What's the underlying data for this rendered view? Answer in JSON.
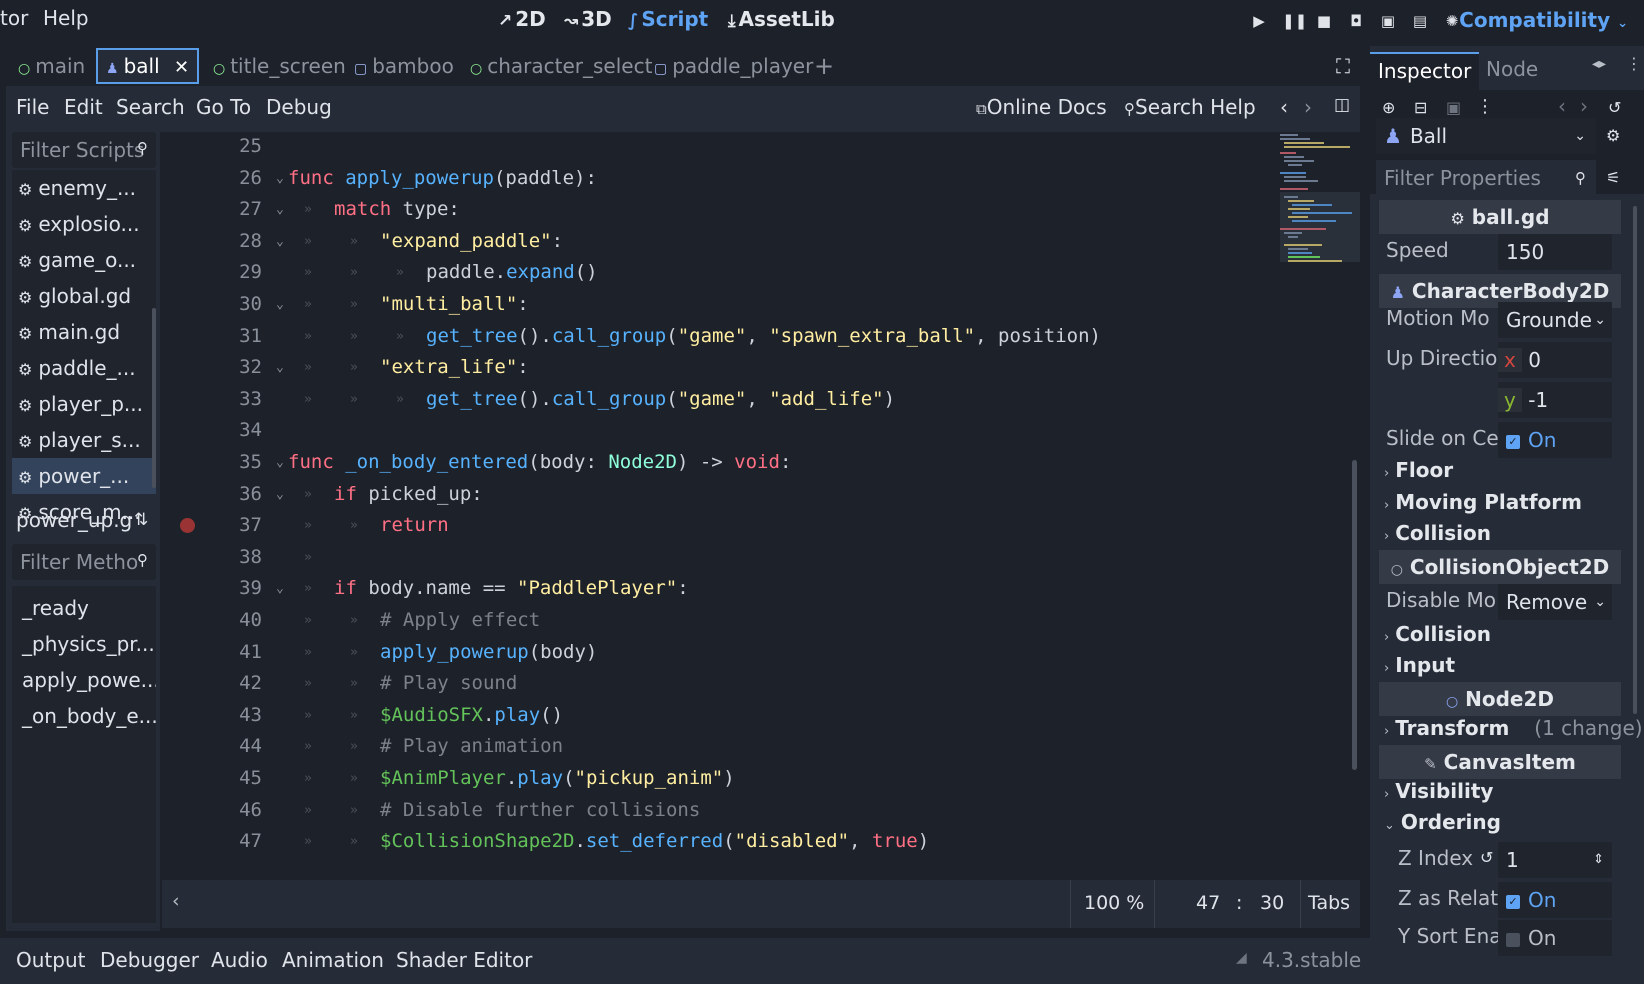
{
  "topbar": {
    "menus": [
      "tor",
      "Help"
    ],
    "workspaces": [
      {
        "label": "2D",
        "glyph": "↗"
      },
      {
        "label": "3D",
        "glyph": "↝"
      },
      {
        "label": "Script",
        "glyph": "∫"
      },
      {
        "label": "AssetLib",
        "glyph": "⤓"
      }
    ],
    "active_workspace": "Script",
    "renderer": "Compatibility"
  },
  "scene_tabs": [
    {
      "label": "main",
      "icon": "circle-icon"
    },
    {
      "label": "ball",
      "icon": "character-icon",
      "selected": true
    },
    {
      "label": "title_screen",
      "icon": "circle-icon"
    },
    {
      "label": "bamboo",
      "icon": "square-icon"
    },
    {
      "label": "character_select",
      "icon": "circle-icon"
    },
    {
      "label": "paddle_player",
      "icon": "square-icon"
    }
  ],
  "script_menu": [
    "File",
    "Edit",
    "Search",
    "Go To",
    "Debug"
  ],
  "script_buttons": {
    "online_docs": "Online Docs",
    "search_help": "Search Help"
  },
  "script_list": {
    "filter_placeholder": "Filter Scripts",
    "items": [
      "enemy_...",
      "explosio...",
      "game_o...",
      "global.gd",
      "main.gd",
      "paddle_...",
      "player_p...",
      "player_s...",
      "power_...",
      "score_m..."
    ],
    "selected": "power_..."
  },
  "current_script": "power_up.g",
  "methods": {
    "filter_placeholder": "Filter Metho",
    "items": [
      "_ready",
      "_physics_pr...",
      "apply_powe...",
      "_on_body_e..."
    ]
  },
  "code_lines": [
    {
      "n": "25",
      "fold": false,
      "tabs": 0,
      "html": ""
    },
    {
      "n": "26",
      "fold": true,
      "tabs": 0,
      "html": "<span class='kw'>func</span> <span class='fn'>apply_powerup</span>(paddle):"
    },
    {
      "n": "27",
      "fold": true,
      "tabs": 1,
      "html": "<span class='kw'>match</span> type:"
    },
    {
      "n": "28",
      "fold": true,
      "tabs": 2,
      "html": "<span class='st'>\"expand_paddle\"</span>:"
    },
    {
      "n": "29",
      "fold": false,
      "tabs": 3,
      "html": "paddle.<span class='fn'>expand</span>()"
    },
    {
      "n": "30",
      "fold": true,
      "tabs": 2,
      "html": "<span class='st'>\"multi_ball\"</span>:"
    },
    {
      "n": "31",
      "fold": false,
      "tabs": 3,
      "html": "<span class='fn'>get_tree</span>().<span class='fn'>call_group</span>(<span class='st'>\"game\"</span>, <span class='st'>\"spawn_extra_ball\"</span>, position)"
    },
    {
      "n": "32",
      "fold": true,
      "tabs": 2,
      "html": "<span class='st'>\"extra_life\"</span>:"
    },
    {
      "n": "33",
      "fold": false,
      "tabs": 3,
      "html": "<span class='fn'>get_tree</span>().<span class='fn'>call_group</span>(<span class='st'>\"game\"</span>, <span class='st'>\"add_life\"</span>)"
    },
    {
      "n": "34",
      "fold": false,
      "tabs": 0,
      "html": ""
    },
    {
      "n": "35",
      "fold": true,
      "tabs": 0,
      "html": "<span class='kw'>func</span> <span class='fn'>_on_body_entered</span>(body: <span class='ty'>Node2D</span>) -&gt; <span class='kw'>void</span>:"
    },
    {
      "n": "36",
      "fold": true,
      "tabs": 1,
      "html": "<span class='kw'>if</span> picked_up:"
    },
    {
      "n": "37",
      "fold": false,
      "tabs": 2,
      "html": "<span class='kw'>return</span>"
    },
    {
      "n": "38",
      "fold": false,
      "tabs": 1,
      "html": ""
    },
    {
      "n": "39",
      "fold": true,
      "tabs": 1,
      "html": "<span class='kw'>if</span> body.name == <span class='st'>\"PaddlePlayer\"</span>:"
    },
    {
      "n": "40",
      "fold": false,
      "tabs": 2,
      "html": "<span class='cm'># Apply effect</span>"
    },
    {
      "n": "41",
      "fold": false,
      "tabs": 2,
      "html": "<span class='fn'>apply_powerup</span>(body)"
    },
    {
      "n": "42",
      "fold": false,
      "tabs": 2,
      "html": "<span class='cm'># Play sound</span>"
    },
    {
      "n": "43",
      "fold": false,
      "tabs": 2,
      "html": "<span class='nd'>$AudioSFX</span>.<span class='fn'>play</span>()"
    },
    {
      "n": "44",
      "fold": false,
      "tabs": 2,
      "html": "<span class='cm'># Play animation</span>"
    },
    {
      "n": "45",
      "fold": false,
      "tabs": 2,
      "html": "<span class='nd'>$AnimPlayer</span>.<span class='fn'>play</span>(<span class='st'>\"pickup_anim\"</span>)"
    },
    {
      "n": "46",
      "fold": false,
      "tabs": 2,
      "html": "<span class='cm'># Disable further collisions</span>"
    },
    {
      "n": "47",
      "fold": false,
      "tabs": 2,
      "html": "<span class='nd'>$CollisionShape2D</span>.<span class='fn'>set_deferred</span>(<span class='st'>\"disabled\"</span>, <span class='kw'>true</span>)"
    }
  ],
  "breakpoint_line": "37",
  "status": {
    "zoom": "100 %",
    "line": "47",
    "sep": ":",
    "col": "30",
    "indent": "Tabs"
  },
  "bottom_panels": [
    "Output",
    "Debugger",
    "Audio",
    "Animation",
    "Shader Editor"
  ],
  "version": "4.3.stable",
  "inspector": {
    "tabs": [
      "Inspector",
      "Node"
    ],
    "node_name": "Ball",
    "filter_placeholder": "Filter Properties",
    "script_section": "ball.gd",
    "speed_label": "Speed",
    "speed_value": "150",
    "body_section": "CharacterBody2D",
    "motion_label": "Motion Mo",
    "motion_value": "Grounde",
    "updir_label": "Up Directio",
    "updir_x_label": "x",
    "updir_x": "0",
    "updir_y_label": "y",
    "updir_y": "-1",
    "slide_label": "Slide on Cei",
    "slide_value": "On",
    "floor": "Floor",
    "moving_platform": "Moving Platform",
    "collision": "Collision",
    "collobj_section": "CollisionObject2D",
    "disable_label": "Disable Mo",
    "disable_value": "Remove",
    "collision2": "Collision",
    "input": "Input",
    "node2d_section": "Node2D",
    "transform": "Transform",
    "transform_note": "(1 change)",
    "canvas_section": "CanvasItem",
    "visibility": "Visibility",
    "ordering": "Ordering",
    "zindex_label": "Z Index",
    "zindex_value": "1",
    "zrel_label": "Z as Relati",
    "zrel_value": "On",
    "ysort_label": "Y Sort Ena",
    "ysort_value": "On"
  }
}
